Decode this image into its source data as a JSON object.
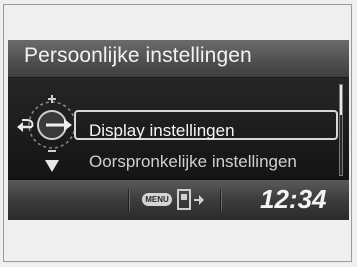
{
  "screen": {
    "title": "Persoonlijke instellingen",
    "menu": {
      "items": [
        {
          "label": "Display instellingen",
          "selected": true
        },
        {
          "label": "Oorspronkelijke instellingen",
          "selected": false
        }
      ]
    },
    "status": {
      "menu_badge": "MENU",
      "clock": "12:34"
    },
    "icons": {
      "knob": "selector-knob-icon",
      "back": "back-arrow-icon",
      "down": "down-arrow-icon",
      "door": "door-exit-icon"
    }
  }
}
